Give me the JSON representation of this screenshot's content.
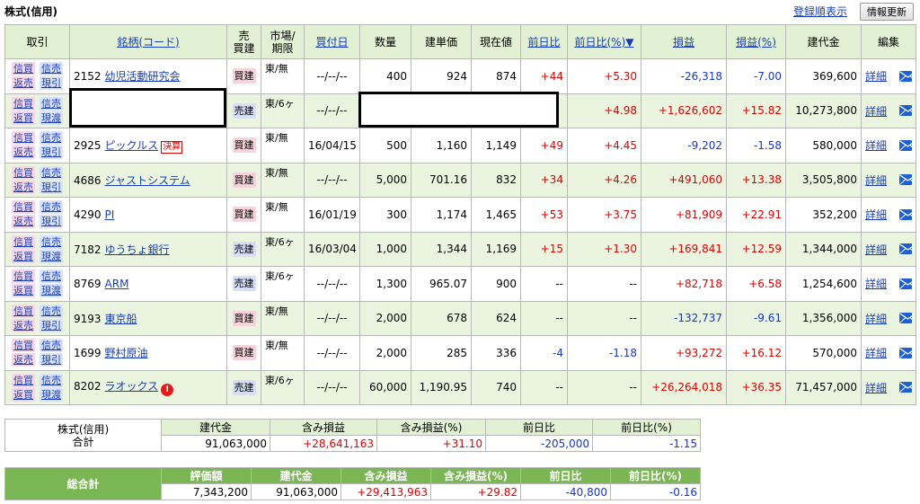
{
  "page_title": "株式(信用)",
  "register_order_link": "登録順表示",
  "refresh_button": "情報更新",
  "headers": {
    "trade": "取引",
    "stock": "銘柄(コード)",
    "side": "売\n買建",
    "market": "市場/\n期限",
    "buy_date": "買付日",
    "qty": "数量",
    "entry_price": "建単価",
    "current_price": "現在値",
    "day_change": "前日比",
    "day_change_pct": "前日比(%)▼",
    "pnl": "損益",
    "pnl_pct": "損益(%)",
    "position_value": "建代金",
    "edit": "編集"
  },
  "trade_buttons": {
    "shinkai": "信買",
    "hensai": "返売",
    "shinbai": "信売",
    "genbiki": "現引",
    "genwatashi": "現渡",
    "hensai_buy": "返買"
  },
  "detail_label": "詳細",
  "kessan_label": "決算",
  "rows": [
    {
      "type": "long",
      "code": "2152",
      "name": "幼児活動研究会",
      "tag": "",
      "alert": false,
      "side": "買建",
      "market": "東/無",
      "buy_date": "--/--/--",
      "qty": "400",
      "entry_price": "924",
      "current_price": "874",
      "day_change": "+44",
      "day_change_color": "red",
      "day_change_pct": "+5.30",
      "day_change_pct_color": "red",
      "pnl": "-26,318",
      "pnl_color": "blue",
      "pnl_pct": "-7.00",
      "pnl_pct_color": "blue",
      "position_value": "369,600"
    },
    {
      "type": "short",
      "code": "",
      "name": "",
      "tag": "",
      "alert": false,
      "side": "売建",
      "market": "東/6ヶ",
      "buy_date": "--/--/--",
      "qty": "",
      "entry_price": "",
      "current_price": "",
      "day_change": "",
      "day_change_color": "red",
      "day_change_pct": "+4.98",
      "day_change_pct_color": "red",
      "pnl": "+1,626,602",
      "pnl_color": "red",
      "pnl_pct": "+15.82",
      "pnl_pct_color": "red",
      "position_value": "10,273,800"
    },
    {
      "type": "long",
      "code": "2925",
      "name": "ピックルス",
      "tag": "決算",
      "alert": false,
      "side": "買建",
      "market": "東/無",
      "buy_date": "16/04/15",
      "qty": "500",
      "entry_price": "1,160",
      "current_price": "1,149",
      "day_change": "+49",
      "day_change_color": "red",
      "day_change_pct": "+4.45",
      "day_change_pct_color": "red",
      "pnl": "-9,202",
      "pnl_color": "blue",
      "pnl_pct": "-1.58",
      "pnl_pct_color": "blue",
      "position_value": "580,000"
    },
    {
      "type": "long",
      "code": "4686",
      "name": "ジャストシステム",
      "tag": "",
      "alert": false,
      "side": "買建",
      "market": "東/無",
      "buy_date": "--/--/--",
      "qty": "5,000",
      "entry_price": "701.16",
      "current_price": "832",
      "day_change": "+34",
      "day_change_color": "red",
      "day_change_pct": "+4.26",
      "day_change_pct_color": "red",
      "pnl": "+491,060",
      "pnl_color": "red",
      "pnl_pct": "+13.38",
      "pnl_pct_color": "red",
      "position_value": "3,505,800"
    },
    {
      "type": "long",
      "code": "4290",
      "name": "PI",
      "tag": "",
      "alert": false,
      "side": "買建",
      "market": "東/無",
      "buy_date": "16/01/19",
      "qty": "300",
      "entry_price": "1,174",
      "current_price": "1,465",
      "day_change": "+53",
      "day_change_color": "red",
      "day_change_pct": "+3.75",
      "day_change_pct_color": "red",
      "pnl": "+81,909",
      "pnl_color": "red",
      "pnl_pct": "+22.91",
      "pnl_pct_color": "red",
      "position_value": "352,200"
    },
    {
      "type": "short",
      "code": "7182",
      "name": "ゆうちょ銀行",
      "tag": "",
      "alert": false,
      "side": "売建",
      "market": "東/6ヶ",
      "buy_date": "16/03/04",
      "qty": "1,000",
      "entry_price": "1,344",
      "current_price": "1,169",
      "day_change": "+15",
      "day_change_color": "red",
      "day_change_pct": "+1.30",
      "day_change_pct_color": "red",
      "pnl": "+169,841",
      "pnl_color": "red",
      "pnl_pct": "+12.59",
      "pnl_pct_color": "red",
      "position_value": "1,344,000"
    },
    {
      "type": "short",
      "code": "8769",
      "name": "ARM",
      "tag": "",
      "alert": false,
      "side": "売建",
      "market": "東/6ヶ",
      "buy_date": "--/--/--",
      "qty": "1,300",
      "entry_price": "965.07",
      "current_price": "900",
      "day_change": "--",
      "day_change_color": "black",
      "day_change_pct": "--",
      "day_change_pct_color": "black",
      "pnl": "+82,718",
      "pnl_color": "red",
      "pnl_pct": "+6.58",
      "pnl_pct_color": "red",
      "position_value": "1,254,600"
    },
    {
      "type": "long",
      "code": "9193",
      "name": "東京船",
      "tag": "",
      "alert": false,
      "side": "買建",
      "market": "東/無",
      "buy_date": "--/--/--",
      "qty": "2,000",
      "entry_price": "678",
      "current_price": "624",
      "day_change": "--",
      "day_change_color": "black",
      "day_change_pct": "--",
      "day_change_pct_color": "black",
      "pnl": "-132,737",
      "pnl_color": "blue",
      "pnl_pct": "-9.61",
      "pnl_pct_color": "blue",
      "position_value": "1,356,000"
    },
    {
      "type": "long",
      "code": "1699",
      "name": "野村原油",
      "tag": "",
      "alert": false,
      "side": "買建",
      "market": "東/無",
      "buy_date": "--/--/--",
      "qty": "2,000",
      "entry_price": "285",
      "current_price": "336",
      "day_change": "-4",
      "day_change_color": "blue",
      "day_change_pct": "-1.18",
      "day_change_pct_color": "blue",
      "pnl": "+93,272",
      "pnl_color": "red",
      "pnl_pct": "+16.12",
      "pnl_pct_color": "red",
      "position_value": "570,000"
    },
    {
      "type": "short",
      "code": "8202",
      "name": "ラオックス",
      "tag": "",
      "alert": true,
      "side": "売建",
      "market": "東/6ヶ",
      "buy_date": "--/--/--",
      "qty": "60,000",
      "entry_price": "1,190.95",
      "current_price": "740",
      "day_change": "--",
      "day_change_color": "black",
      "day_change_pct": "--",
      "day_change_pct_color": "black",
      "pnl": "+26,264,018",
      "pnl_color": "red",
      "pnl_pct": "+36.35",
      "pnl_pct_color": "red",
      "position_value": "71,457,000"
    }
  ],
  "subtotal": {
    "label": "株式(信用)",
    "label2": "合計",
    "headers": [
      "建代金",
      "含み損益",
      "含み損益(%)",
      "前日比",
      "前日比(%)"
    ],
    "values": [
      "91,063,000",
      "+28,641,163",
      "+31.10",
      "-205,000",
      "-1.15"
    ],
    "colors": [
      "black",
      "red",
      "red",
      "blue",
      "blue"
    ]
  },
  "grand_total": {
    "label": "総合計",
    "headers": [
      "評価額",
      "建代金",
      "含み損益",
      "含み損益(%)",
      "前日比",
      "前日比(%)"
    ],
    "values": [
      "7,343,200",
      "91,063,000",
      "+29,413,963",
      "+29.82",
      "-40,800",
      "-0.16"
    ],
    "colors": [
      "black",
      "black",
      "red",
      "red",
      "blue",
      "blue"
    ]
  },
  "colors": {
    "header_bg": "#e2f1d4",
    "even_row_bg": "#eaf4df",
    "grand_header_bg": "#7bb654",
    "positive": "#e00000",
    "negative": "#1636d8",
    "link": "#1a3fb5"
  }
}
